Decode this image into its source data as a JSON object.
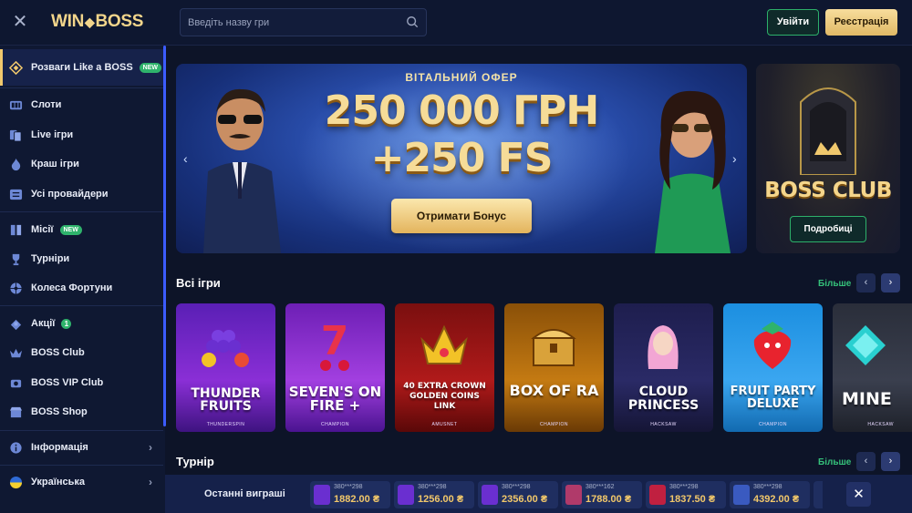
{
  "header": {
    "logo_left": "WIN",
    "logo_right": "BOSS",
    "search_placeholder": "Введіть назву гри",
    "login_label": "Увійти",
    "register_label": "Реєстрація"
  },
  "sidebar": {
    "featured": {
      "label": "Розваги Like a BOSS",
      "badge": "NEW",
      "icon": "diamond-icon"
    },
    "items": [
      {
        "label": "Слоти",
        "icon": "slot-machine-icon"
      },
      {
        "label": "Live ігри",
        "icon": "cards-icon"
      },
      {
        "label": "Краш ігри",
        "icon": "flame-icon"
      },
      {
        "label": "Усі провайдери",
        "icon": "list-icon"
      },
      {
        "label": "Місії",
        "icon": "book-icon",
        "badge": "NEW"
      },
      {
        "label": "Турніри",
        "icon": "trophy-icon"
      },
      {
        "label": "Колеса Фортуни",
        "icon": "wheel-icon"
      },
      {
        "label": "Акції",
        "icon": "gift-icon",
        "badge": "1"
      },
      {
        "label": "BOSS Club",
        "icon": "crown-icon"
      },
      {
        "label": "BOSS VIP Club",
        "icon": "vip-icon"
      },
      {
        "label": "BOSS Shop",
        "icon": "shop-icon"
      },
      {
        "label": "Інформація",
        "icon": "info-icon"
      },
      {
        "label": "Українська",
        "icon": "ukraine-flag-icon"
      }
    ]
  },
  "banner": {
    "offer_label": "ВІТАЛЬНИЙ ОФЕР",
    "amount": "250 000 ГРН",
    "free_spins": "+250 FS",
    "cta_label": "Отримати Бонус"
  },
  "boss_club_banner": {
    "title": "BOSS CLUB",
    "more_label": "Подробиці"
  },
  "all_games": {
    "title": "Всі ігри",
    "more_label": "Більше",
    "games": [
      {
        "name": "THUNDER FRUITS",
        "provider": "THUNDERSPIN",
        "color": "#8a2fd6"
      },
      {
        "name": "SEVEN'S ON FIRE +",
        "provider": "CHAMPION",
        "color": "#a23fe0"
      },
      {
        "name": "40 EXTRA CROWN GOLDEN COINS LINK",
        "provider": "AMUSNET",
        "color": "#b01a1a"
      },
      {
        "name": "BOX OF RA",
        "provider": "CHAMPION",
        "color": "#c47a12"
      },
      {
        "name": "CLOUD PRINCESS",
        "provider": "HACKSAW",
        "color": "#2a2a66"
      },
      {
        "name": "FRUIT PARTY DELUXE",
        "provider": "CHAMPION",
        "color": "#1c8fe0"
      },
      {
        "name": "MINE",
        "provider": "HACKSAW",
        "color": "#2a2e3a"
      }
    ]
  },
  "tournament": {
    "title": "Турнір",
    "more_label": "Більше"
  },
  "last_wins": {
    "label": "Останні виграші",
    "items": [
      {
        "user": "380***298",
        "amount": "1882.00 ₴"
      },
      {
        "user": "380***298",
        "amount": "1256.00 ₴"
      },
      {
        "user": "380***298",
        "amount": "2356.00 ₴"
      },
      {
        "user": "380***162",
        "amount": "1788.00 ₴"
      },
      {
        "user": "380***298",
        "amount": "1837.50 ₴"
      },
      {
        "user": "380***298",
        "amount": "4392.00 ₴"
      }
    ]
  }
}
